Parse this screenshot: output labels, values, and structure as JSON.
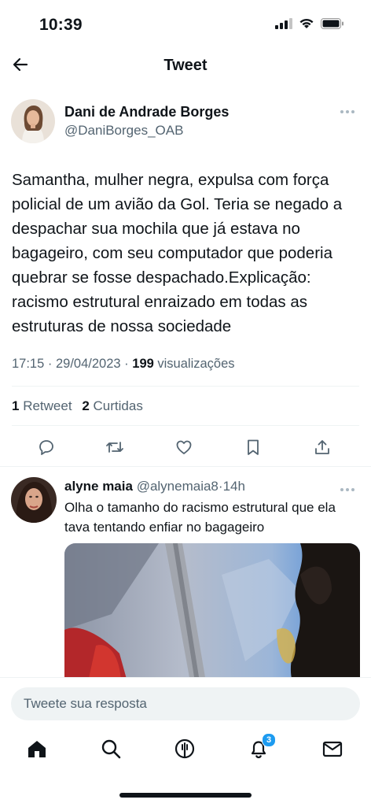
{
  "status_bar": {
    "time": "10:39",
    "icons": [
      "signal-icon",
      "wifi-icon",
      "battery-icon"
    ]
  },
  "header": {
    "title": "Tweet",
    "back_icon": "arrow-left-icon"
  },
  "tweet": {
    "author_name": "Dani de Andrade Borges",
    "author_handle": "@DaniBorges_OAB",
    "text": "Samantha, mulher negra, expulsa com força policial de um avião da Gol. Teria se negado a despachar sua mochila que já estava no bagageiro, com seu computador que poderia quebrar se fosse despachado.Explicação: racismo estrutural enraizado em todas as estruturas de nossa sociedade",
    "time": "17:15",
    "date": "29/04/2023",
    "views_count": "199",
    "views_label": "visualizações",
    "retweets_count": "1",
    "retweets_label": "Retweet",
    "likes_count": "2",
    "likes_label": "Curtidas"
  },
  "actions": [
    "reply-icon",
    "retweet-icon",
    "like-icon",
    "bookmark-icon",
    "share-icon"
  ],
  "reply": {
    "name": "alyne maia",
    "handle": "@alynemaia8",
    "time": "14h",
    "text": "Olha o tamanho do racismo estrutural que ela tava tentando enfiar no bagageiro"
  },
  "compose": {
    "placeholder": "Tweete sua resposta"
  },
  "tabbar": {
    "items": [
      "home-icon",
      "search-icon",
      "spaces-icon",
      "notifications-icon",
      "messages-icon"
    ],
    "notification_badge": "3"
  },
  "colors": {
    "accent": "#1d9bf0",
    "text": "#0f1419",
    "secondary": "#536471",
    "divider": "#eff3f4"
  }
}
